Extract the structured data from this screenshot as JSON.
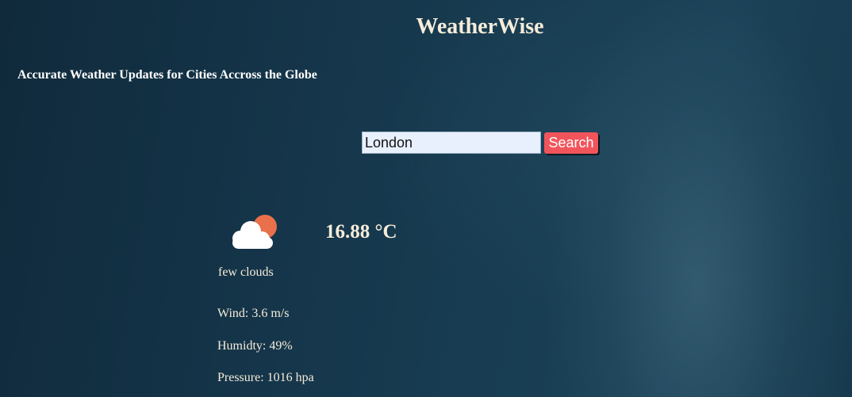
{
  "header": {
    "title": "WeatherWise",
    "subtitle": "Accurate Weather Updates for Cities Accross the Globe"
  },
  "search": {
    "value": "London",
    "placeholder": "",
    "button_label": "Search"
  },
  "weather": {
    "icon": "few-clouds-icon",
    "temperature": "16.88 °C",
    "description": "few clouds",
    "wind": "Wind: 3.6 m/s",
    "humidity": "Humidty: 49%",
    "pressure": "Pressure: 1016 hpa"
  },
  "colors": {
    "background": "#15354a",
    "text": "#f5ecd9",
    "button": "#f2545b",
    "input_background": "#e8f0fe",
    "sun": "#e8704a",
    "cloud": "#ffffff"
  }
}
